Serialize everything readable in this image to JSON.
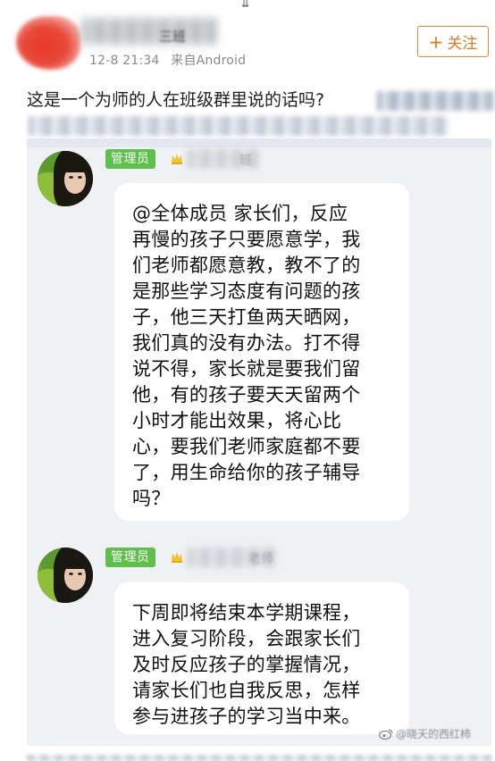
{
  "header": {
    "top_glyph": "⇊",
    "username_visible": "三班",
    "date": "12-8",
    "time": "21:34",
    "source": "来自Android",
    "follow_button": {
      "icon": "plus-icon",
      "label": "关注",
      "color": "#e2791f"
    },
    "avatar_color": "#e8372a"
  },
  "post": {
    "text": "这是一个为师的人在班级群里说的话吗?"
  },
  "chat": {
    "background": "#eff1f5",
    "badge_color": "#5ec04a",
    "messages": [
      {
        "badge": "管理员",
        "sender_tail": "班",
        "text": "@全体成员 家长们，反应\n再慢的孩子只要愿意学，我\n们老师都愿意教，教不了的\n是那些学习态度有问题的孩\n子，他三天打鱼两天晒网，\n我们真的没有办法。打不得\n说不得，家长就是要我们留\n他，有的孩子要天天留两个\n小时才能出效果，将心比\n心，要我们老师家庭都不要\n了，用生命给你的孩子辅导\n吗？"
      },
      {
        "badge": "管理员",
        "sender_tail": "老师",
        "text": "下周即将结束本学期课程，\n进入复习阶段，会跟家长们\n及时反应孩子的掌握情况，\n请家长们也自我反思，怎样\n参与进孩子的学习当中来。"
      }
    ]
  },
  "watermark": {
    "icon": "weibo-icon",
    "text": "@晓天的西红柿"
  }
}
